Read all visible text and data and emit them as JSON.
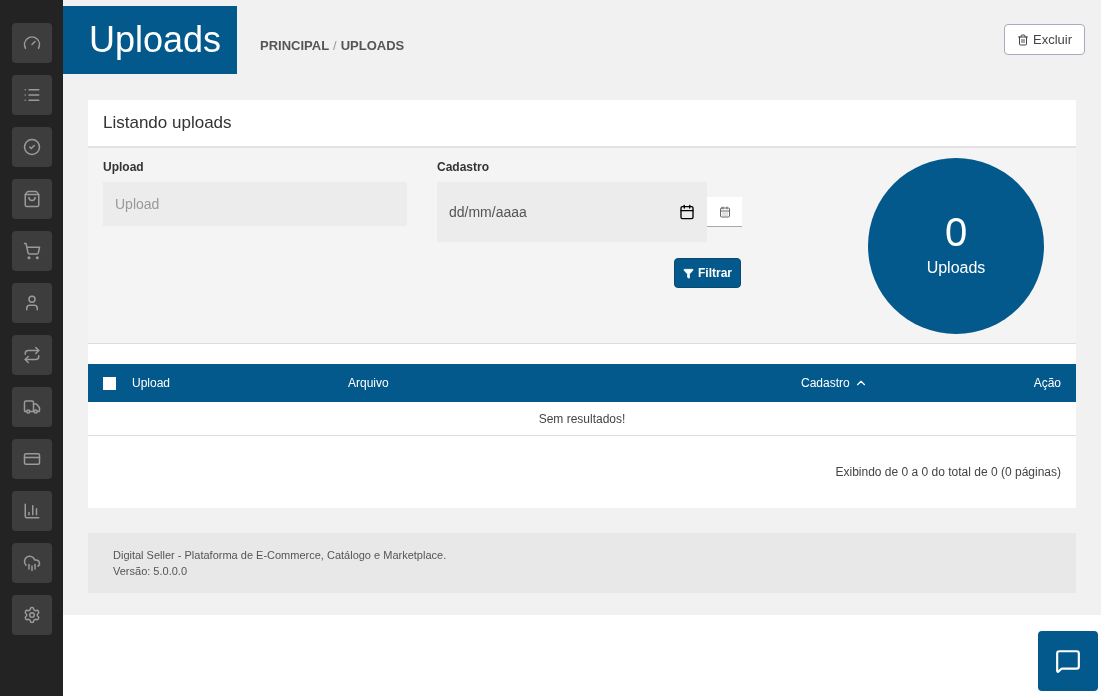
{
  "page_title": "Uploads",
  "breadcrumb": [
    {
      "label": "PRINCIPAL"
    },
    {
      "label": "UPLOADS"
    }
  ],
  "breadcrumb_separator": "/",
  "delete_button": {
    "label": "Excluir"
  },
  "panel": {
    "title": "Listando uploads"
  },
  "filters": {
    "upload": {
      "label": "Upload",
      "placeholder": "Upload"
    },
    "cadastro": {
      "label": "Cadastro",
      "placeholder": "dd/mm/aaaa"
    },
    "filter_button": "Filtrar"
  },
  "counter": {
    "value": "0",
    "label": "Uploads"
  },
  "table": {
    "select_all_checked": false,
    "columns": [
      {
        "label": "Upload",
        "sorted": false
      },
      {
        "label": "Arquivo",
        "sorted": false
      },
      {
        "label": "Cadastro",
        "sorted": true
      },
      {
        "label": "Ação",
        "sorted": false
      }
    ],
    "empty_message": "Sem resultados!",
    "summary": "Exibindo de 0 a 0 do total de 0 (0 páginas)"
  },
  "footer": {
    "line1": "Digital Seller - Plataforma de E-Commerce, Catálogo e Marketplace.",
    "line2": "Versão: 5.0.0.0"
  }
}
